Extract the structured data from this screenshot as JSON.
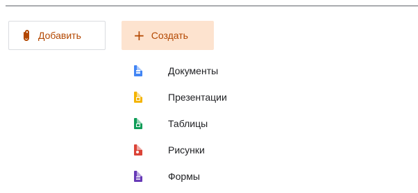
{
  "toolbar": {
    "add_label": "Добавить",
    "create_label": "Создать",
    "add_icon": "paperclip-icon",
    "create_icon": "plus-icon",
    "accent_color": "#b34700",
    "create_bg_color": "#fde3cf"
  },
  "create_menu": {
    "items": [
      {
        "label": "Документы",
        "icon": "docs-icon",
        "color": "#4285f4"
      },
      {
        "label": "Презентации",
        "icon": "slides-icon",
        "color": "#f4b400"
      },
      {
        "label": "Таблицы",
        "icon": "sheets-icon",
        "color": "#0f9d58"
      },
      {
        "label": "Рисунки",
        "icon": "drawings-icon",
        "color": "#db4437"
      },
      {
        "label": "Формы",
        "icon": "forms-icon",
        "color": "#673ab7"
      }
    ]
  }
}
